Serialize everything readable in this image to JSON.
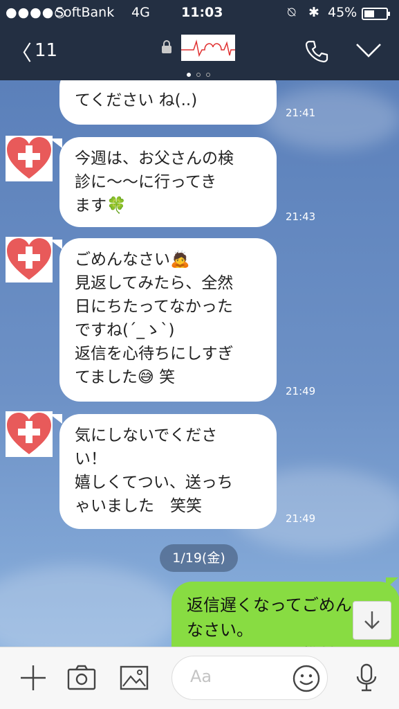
{
  "status_bar": {
    "signal": "●●●●○",
    "carrier": "SoftBank",
    "network": "4G",
    "time": "11:03",
    "lock_icon": "⍉",
    "bluetooth": "✱",
    "battery_percent": "45%",
    "battery_level": 0.45
  },
  "header": {
    "back_glyph": "〈",
    "back_count": "11",
    "page_dots": 3,
    "active_page": 0
  },
  "messages": [
    {
      "text": "てください ね(..)",
      "time": "21:41"
    },
    {
      "text": "今週は、お父さんの検\n診に〜〜に行ってき\nます🍀",
      "time": "21:43"
    },
    {
      "text": "ごめんなさい🙇\n見返してみたら、全然\n日にちたってなかった\nですね(´_ゝ`)\n返信を心待ちにしすぎ\nてました😅 笑",
      "time": "21:49"
    },
    {
      "text": "気にしないでくださ\nい！\n嬉しくてつい、送っち\nゃいました　笑笑",
      "time": "21:49"
    }
  ],
  "date_separator": "1/19(金)",
  "sent_message": "返信遅くなってごめん\nなさい。\nそんなにずっと携帯を",
  "input": {
    "placeholder": "Aa"
  },
  "colors": {
    "header": "#232f42",
    "sent_bubble": "#88dc42",
    "received_bubble": "#ffffff"
  }
}
